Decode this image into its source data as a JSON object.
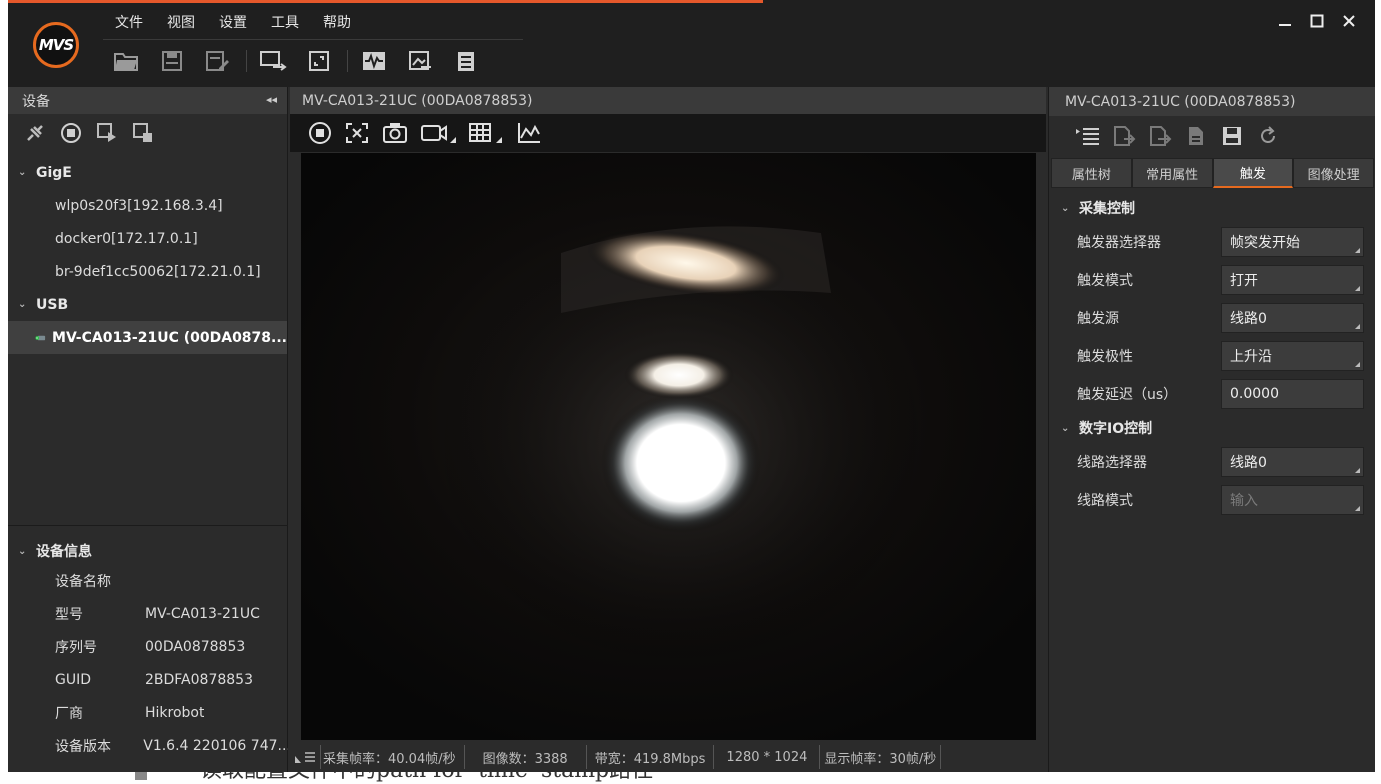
{
  "background": {
    "bottom_text": "读取配置文件中的path for 'time' stamp路径"
  },
  "menu": [
    "文件",
    "视图",
    "设置",
    "工具",
    "帮助"
  ],
  "logo_text": "MVS",
  "left": {
    "header": "设备",
    "groups": [
      {
        "label": "GigE",
        "items": [
          "wlp0s20f3[192.168.3.4]",
          "docker0[172.17.0.1]",
          "br-9def1cc50062[172.21.0.1]"
        ]
      },
      {
        "label": "USB",
        "items": [
          "MV-CA013-21UC (00DA0878..."
        ]
      }
    ],
    "devinfo": {
      "title": "设备信息",
      "rows": [
        {
          "k": "设备名称",
          "v": ""
        },
        {
          "k": "型号",
          "v": "MV-CA013-21UC"
        },
        {
          "k": "序列号",
          "v": "00DA0878853"
        },
        {
          "k": "GUID",
          "v": "2BDFA0878853"
        },
        {
          "k": "厂商",
          "v": "Hikrobot"
        },
        {
          "k": "设备版本",
          "v": "V1.6.4 220106 747..."
        }
      ]
    }
  },
  "center": {
    "header": "MV-CA013-21UC (00DA0878853)",
    "status": [
      "采集帧率：40.04帧/秒",
      "图像数：3388",
      "带宽：419.8Mbps",
      "1280 * 1024",
      "显示帧率：30帧/秒"
    ]
  },
  "right": {
    "header": "MV-CA013-21UC (00DA0878853)",
    "tabs": [
      "属性树",
      "常用属性",
      "触发",
      "图像处理"
    ],
    "active_tab": "触发",
    "groups": [
      {
        "label": "采集控制",
        "rows": [
          {
            "k": "触发器选择器",
            "v": "帧突发开始"
          },
          {
            "k": "触发模式",
            "v": "打开"
          },
          {
            "k": "触发源",
            "v": "线路0"
          },
          {
            "k": "触发极性",
            "v": "上升沿"
          },
          {
            "k": "触发延迟（us）",
            "v": "0.0000"
          }
        ]
      },
      {
        "label": "数字IO控制",
        "rows": [
          {
            "k": "线路选择器",
            "v": "线路0"
          },
          {
            "k": "线路模式",
            "v": "输入"
          }
        ]
      }
    ]
  },
  "colors": {
    "accent": "#e66a1f",
    "panel": "#2b2b2b",
    "header": "#3a3a3a"
  }
}
